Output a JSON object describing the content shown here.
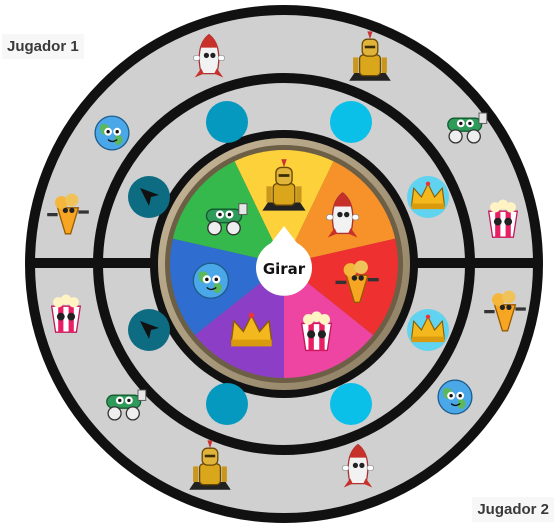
{
  "players": {
    "player1": "Jugador 1",
    "player2": "Jugador 2"
  },
  "spinner": {
    "label": "Girar",
    "segments": [
      {
        "color": "#fcd13a",
        "character": "knight"
      },
      {
        "color": "#f7922b",
        "character": "rocket"
      },
      {
        "color": "#ee3030",
        "character": "popcorn-cone"
      },
      {
        "color": "#ee44a2",
        "character": "popcorn-box"
      },
      {
        "color": "#8c3fc6",
        "character": "crown"
      },
      {
        "color": "#2f6ed0",
        "character": "globe"
      },
      {
        "color": "#35b84c",
        "character": "cannon"
      }
    ]
  },
  "colors": {
    "board": "#d0d0d0",
    "ring_stroke": "#111111",
    "slot_light": "#0bc0e8",
    "slot_dark": "#0699bf",
    "arrow_slot": "#0d6b82",
    "crown_slot": "#5fd3ef"
  },
  "outer_ring": {
    "top_half": [
      "rocket",
      "knight",
      "cannon",
      "popcorn-box",
      "popcorn-cone",
      "globe"
    ],
    "bottom_half": [
      "popcorn-cone",
      "globe",
      "rocket",
      "knight",
      "cannon",
      "popcorn-box"
    ]
  },
  "middle_ring": {
    "top_half": [
      "empty-slot",
      "empty-slot",
      "crown-slot",
      "arrow-slot"
    ],
    "bottom_half": [
      "crown-slot",
      "empty-slot",
      "empty-slot",
      "arrow-slot"
    ]
  }
}
